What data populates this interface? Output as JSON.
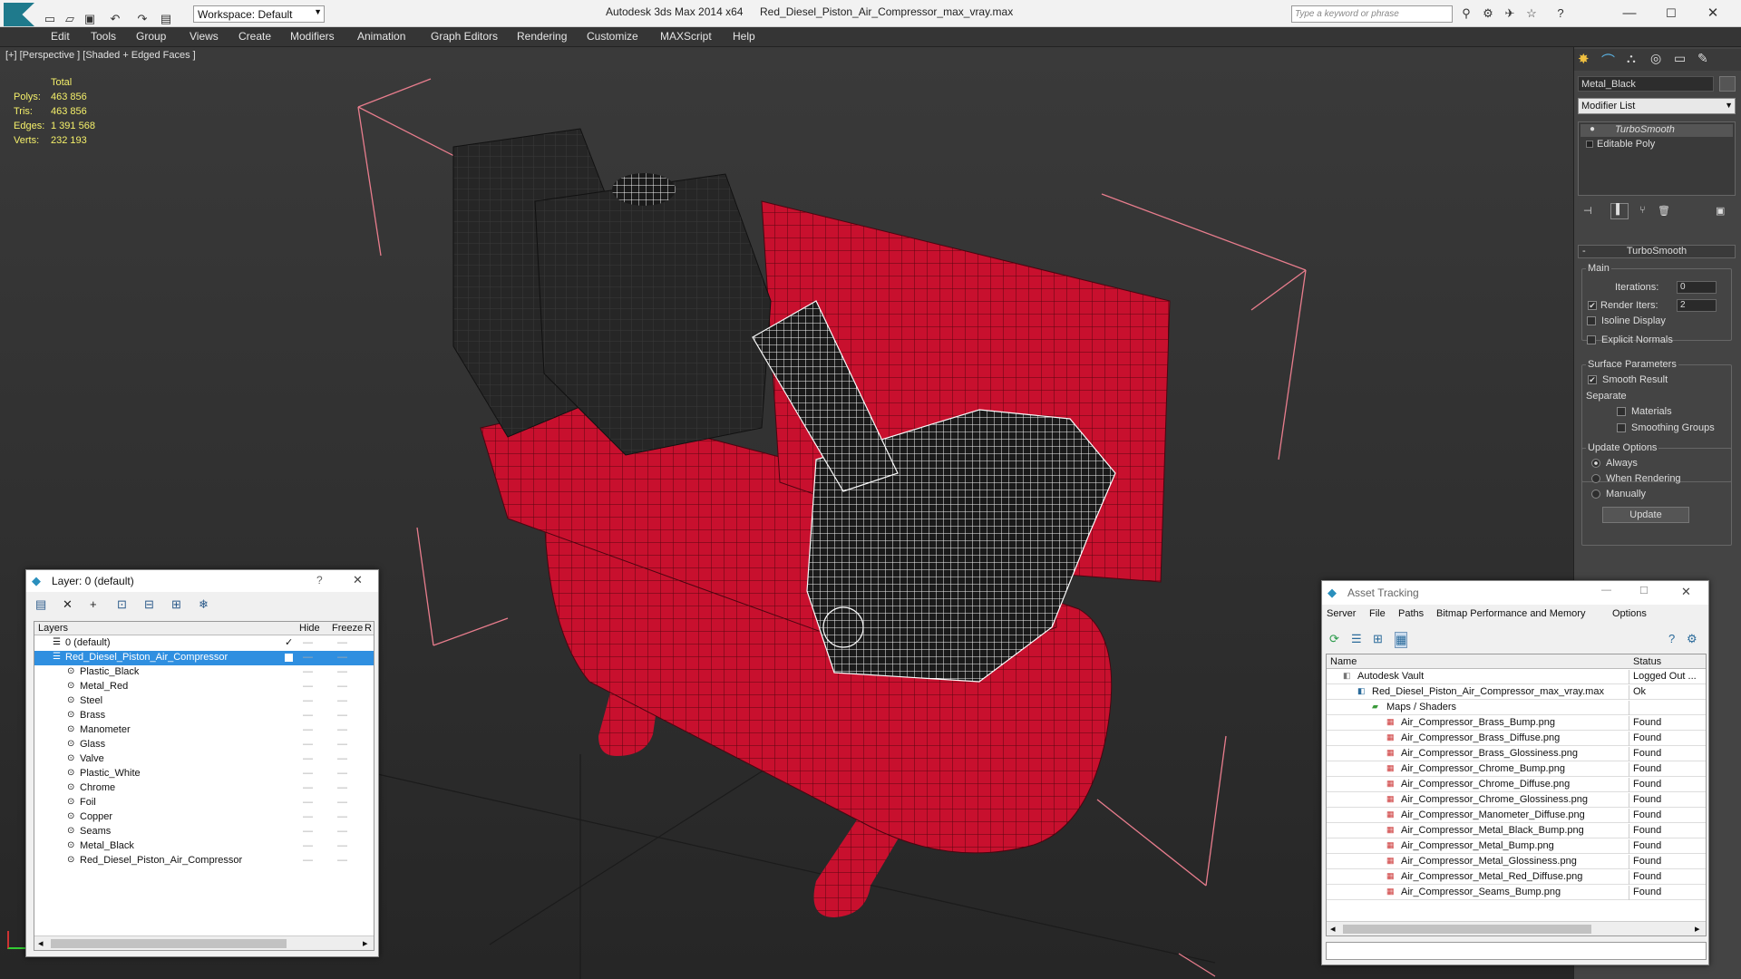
{
  "titlebar": {
    "workspace": "Workspace: Default",
    "app_title": "Autodesk 3ds Max  2014 x64",
    "file_title": "Red_Diesel_Piston_Air_Compressor_max_vray.max",
    "search_placeholder": "Type a keyword or phrase"
  },
  "menu": [
    "Edit",
    "Tools",
    "Group",
    "Views",
    "Create",
    "Modifiers",
    "Animation",
    "Graph Editors",
    "Rendering",
    "Customize",
    "MAXScript",
    "Help"
  ],
  "viewport": {
    "label": "[+] [Perspective ] [Shaded + Edged Faces ]",
    "stats_header": "Total",
    "stats": [
      {
        "label": "Polys:",
        "value": "463 856"
      },
      {
        "label": "Tris:",
        "value": "463 856"
      },
      {
        "label": "Edges:",
        "value": "1 391 568"
      },
      {
        "label": "Verts:",
        "value": "232 193"
      }
    ]
  },
  "command_panel": {
    "object_name": "Metal_Black",
    "modifier_list": "Modifier List",
    "stack": [
      "TurboSmooth",
      "Editable Poly"
    ],
    "rollout_title": "TurboSmooth",
    "main_label": "Main",
    "iterations_label": "Iterations:",
    "iterations_value": "0",
    "render_iters_label": "Render Iters:",
    "render_iters_value": "2",
    "isoline": "Isoline Display",
    "explicit_normals": "Explicit Normals",
    "surface_params": "Surface Parameters",
    "smooth_result": "Smooth Result",
    "separate": "Separate",
    "materials": "Materials",
    "smoothing_groups": "Smoothing Groups",
    "update_options": "Update Options",
    "always": "Always",
    "when_rendering": "When Rendering",
    "manually": "Manually",
    "update_button": "Update"
  },
  "layer_dialog": {
    "title": "Layer: 0 (default)",
    "help": "?",
    "col_layers": "Layers",
    "col_hide": "Hide",
    "col_freeze": "Freeze",
    "col_r": "R",
    "default_layer": "0 (default)",
    "selected_layer": "Red_Diesel_Piston_Air_Compressor",
    "children": [
      "Plastic_Black",
      "Metal_Red",
      "Steel",
      "Brass",
      "Manometer",
      "Glass",
      "Valve",
      "Plastic_White",
      "Chrome",
      "Foil",
      "Copper",
      "Seams",
      "Metal_Black",
      "Red_Diesel_Piston_Air_Compressor"
    ]
  },
  "asset_tracking": {
    "title": "Asset Tracking",
    "menu": [
      "Server",
      "File",
      "Paths",
      "Bitmap Performance and Memory",
      "Options"
    ],
    "col_name": "Name",
    "col_status": "Status",
    "vault": {
      "name": "Autodesk Vault",
      "status": "Logged Out ..."
    },
    "file": {
      "name": "Red_Diesel_Piston_Air_Compressor_max_vray.max",
      "status": "Ok"
    },
    "maps_folder": "Maps / Shaders",
    "files": [
      {
        "name": "Air_Compressor_Brass_Bump.png",
        "status": "Found"
      },
      {
        "name": "Air_Compressor_Brass_Diffuse.png",
        "status": "Found"
      },
      {
        "name": "Air_Compressor_Brass_Glossiness.png",
        "status": "Found"
      },
      {
        "name": "Air_Compressor_Chrome_Bump.png",
        "status": "Found"
      },
      {
        "name": "Air_Compressor_Chrome_Diffuse.png",
        "status": "Found"
      },
      {
        "name": "Air_Compressor_Chrome_Glossiness.png",
        "status": "Found"
      },
      {
        "name": "Air_Compressor_Manometer_Diffuse.png",
        "status": "Found"
      },
      {
        "name": "Air_Compressor_Metal_Black_Bump.png",
        "status": "Found"
      },
      {
        "name": "Air_Compressor_Metal_Bump.png",
        "status": "Found"
      },
      {
        "name": "Air_Compressor_Metal_Glossiness.png",
        "status": "Found"
      },
      {
        "name": "Air_Compressor_Metal_Red_Diffuse.png",
        "status": "Found"
      },
      {
        "name": "Air_Compressor_Seams_Bump.png",
        "status": "Found"
      }
    ]
  },
  "colors": {
    "accent": "#2a8fbd",
    "tank": "#c8102e",
    "selection": "#3399ff"
  }
}
